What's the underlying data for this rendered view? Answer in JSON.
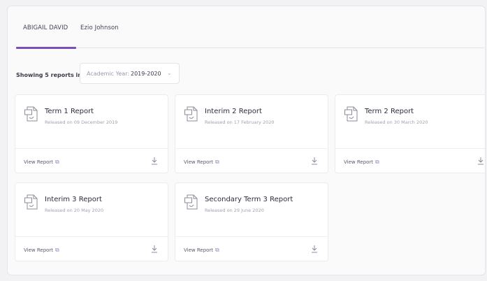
{
  "tabs": [
    {
      "label": "ABIGAIL DAVID",
      "active": true
    },
    {
      "label": "Ezio Johnson",
      "active": false
    }
  ],
  "filter": {
    "showing_label": "Showing 5 reports in",
    "select_label": "Academic Year:",
    "select_value": "2019-2020"
  },
  "colors": {
    "accent": "#7a4fb6"
  },
  "reports": [
    {
      "title": "Term 1 Report",
      "date": "Released on 09 December 2019",
      "view_label": "View Report"
    },
    {
      "title": "Interim 2 Report",
      "date": "Released on 17 February 2020",
      "view_label": "View Report"
    },
    {
      "title": "Term 2 Report",
      "date": "Released on 30 March 2020",
      "view_label": "View Report"
    },
    {
      "title": "Interim 3 Report",
      "date": "Released on 20 May 2020",
      "view_label": "View Report"
    },
    {
      "title": "Secondary Term 3 Report",
      "date": "Released on 29 June 2020",
      "view_label": "View Report"
    }
  ],
  "icons": {
    "doc": "pdf-document-icon",
    "external": "external-link-icon",
    "download": "download-icon"
  }
}
